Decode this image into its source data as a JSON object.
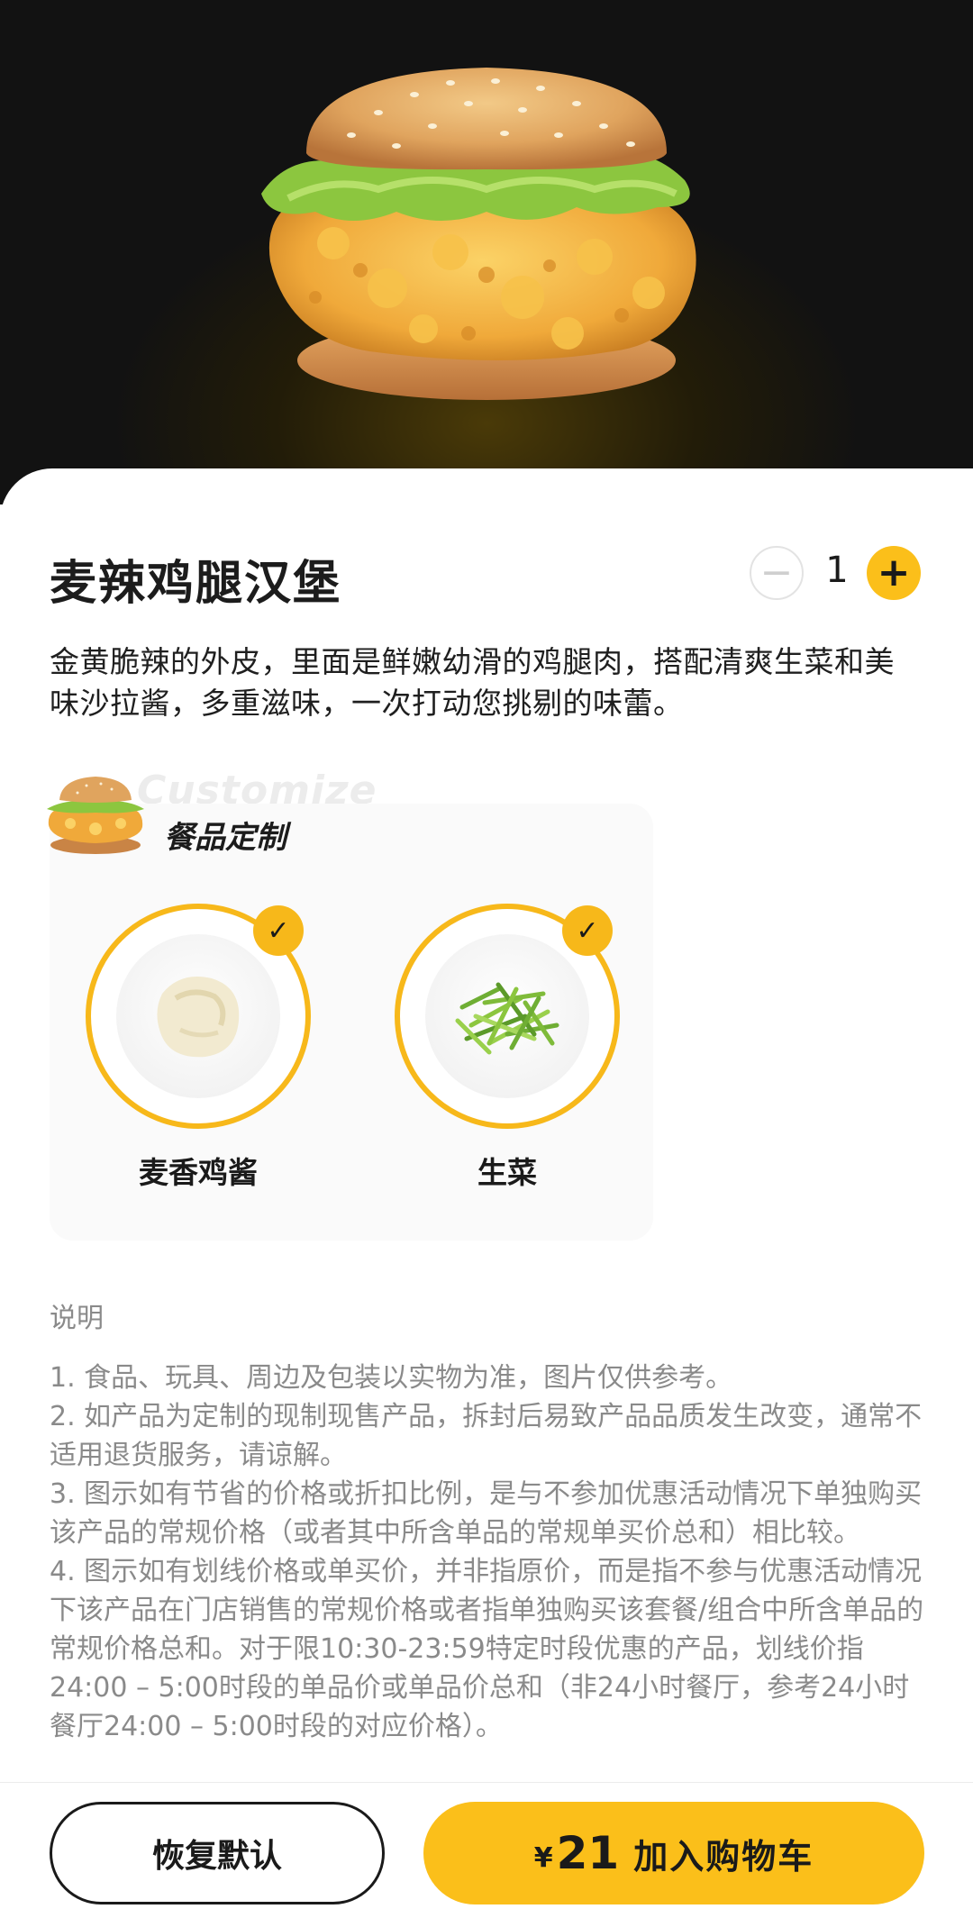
{
  "product": {
    "name": "麦辣鸡腿汉堡",
    "quantity": "1",
    "minus_icon": "−",
    "plus_icon": "+",
    "description": "金黄脆辣的外皮，里面是鲜嫩幼滑的鸡腿肉，搭配清爽生菜和美味沙拉酱，多重滋味，一次打动您挑剔的味蕾。"
  },
  "customize": {
    "watermark": "Customize",
    "title": "餐品定制",
    "options": [
      {
        "label": "麦香鸡酱",
        "selected": true,
        "icon": "sauce-bowl"
      },
      {
        "label": "生菜",
        "selected": true,
        "icon": "lettuce-bowl"
      }
    ],
    "check_glyph": "✓"
  },
  "notes": {
    "heading": "说明",
    "items": [
      "1. 食品、玩具、周边及包装以实物为准，图片仅供参考。",
      "2. 如产品为定制的现制现售产品，拆封后易致产品品质发生改变，通常不适用退货服务，请谅解。",
      "3. 图示如有节省的价格或折扣比例，是与不参加优惠活动情况下单独购买该产品的常规价格（或者其中所含单品的常规单买价总和）相比较。",
      "4. 图示如有划线价格或单买价，并非指原价，而是指不参与优惠活动情况下该产品在门店销售的常规价格或者指单独购买该套餐/组合中所含单品的常规价格总和。对于限10:30-23:59特定时段优惠的产品，划线价指24:00 – 5:00时段的单品价或单品价总和（非24小时餐厅，参考24小时餐厅24:00 – 5:00时段的对应价格）。"
    ]
  },
  "footer": {
    "reset_label": "恢复默认",
    "currency": "¥",
    "price": "21",
    "add_label": "加入购物车"
  },
  "colors": {
    "accent": "#fbbf1a",
    "hero_bg": "#121212",
    "note_text": "#8a8a8a"
  }
}
